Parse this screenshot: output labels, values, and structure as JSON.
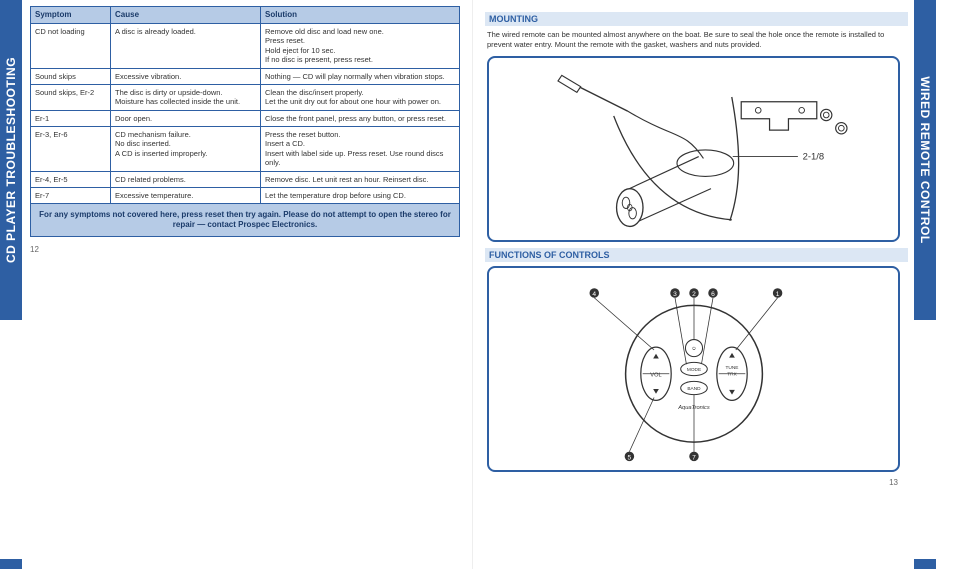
{
  "left_spine": "CD PLAYER TROUBLESHOOTING",
  "right_spine": "WIRED REMOTE CONTROL",
  "table": {
    "headers": [
      "Symptom",
      "Cause",
      "Solution"
    ],
    "rows": [
      {
        "symptom": "CD not loading",
        "cause": "A disc is already loaded.",
        "solution": "Remove old disc and load new one.\nPress reset.\nHold eject for 10 sec.\nIf no disc is present, press reset."
      },
      {
        "symptom": "Sound skips",
        "cause": "Excessive vibration.",
        "solution": "Nothing — CD will play normally when vibration stops."
      },
      {
        "symptom": "Sound skips, Er-2",
        "cause": "The disc is dirty or upside-down.\nMoisture has collected inside the unit.",
        "solution": "Clean the disc/insert properly.\nLet the unit dry out for about one hour with power on."
      },
      {
        "symptom": "Er-1",
        "cause": "Door open.",
        "solution": "Close the front panel, press any button, or press reset."
      },
      {
        "symptom": "Er-3, Er-6",
        "cause": "CD mechanism failure.\nNo disc inserted.\nA CD is inserted improperly.",
        "solution": "Press the reset button.\nInsert a CD.\nInsert with label side up. Press reset. Use round discs only."
      },
      {
        "symptom": "Er-4, Er-5",
        "cause": "CD related problems.",
        "solution": "Remove disc. Let unit rest an hour. Reinsert disc."
      },
      {
        "symptom": "Er-7",
        "cause": "Excessive temperature.",
        "solution": "Let the temperature drop before using CD."
      }
    ],
    "footer": "For any symptoms not covered here, press reset then try again.\nPlease do not attempt to open the stereo for repair — contact Prospec Electronics."
  },
  "left_pagenum": "12",
  "right": {
    "mounting_title": "MOUNTING",
    "mounting_body": "The wired remote can be mounted almost anywhere on the boat. Be sure to seal the hole once the remote is installed to prevent water entry. Mount the remote with the gasket, washers and nuts provided.",
    "dimension_label": "2-1/8",
    "functions_title": "FUNCTIONS OF CONTROLS",
    "controls": {
      "callouts": [
        "1",
        "2",
        "3",
        "4",
        "5",
        "6",
        "7"
      ],
      "labels": {
        "vol": "VOL",
        "mode": "MODE",
        "band": "BAND",
        "tune": "TUNE\\nTRK",
        "brand": "AquaTronics"
      }
    },
    "pagenum": "13"
  }
}
